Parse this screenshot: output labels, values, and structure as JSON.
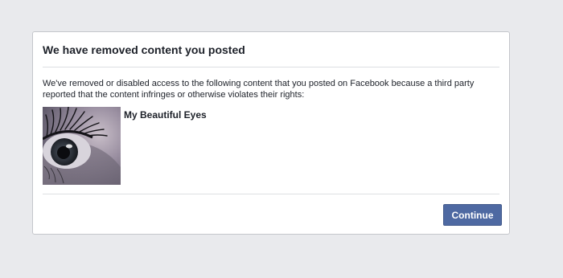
{
  "dialog": {
    "title": "We have removed content you posted",
    "message": "We've removed or disabled access to the following content that you posted on Facebook because a third party reported that the content infringes or otherwise violates their rights:",
    "item": {
      "title": "My Beautiful Eyes",
      "thumbnail_icon": "eye-photo-thumbnail"
    },
    "continue_label": "Continue"
  },
  "colors": {
    "page_background": "#e9eaed",
    "button_primary": "#4e69a2",
    "text": "#1d2129"
  }
}
